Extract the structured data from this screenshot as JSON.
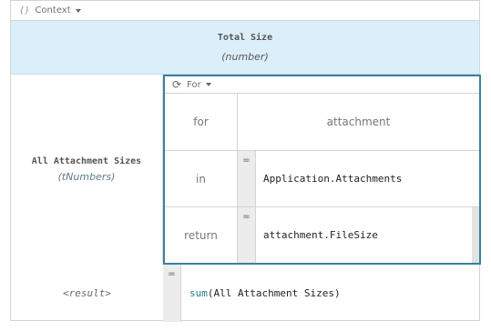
{
  "context_bar": {
    "icon": "{}",
    "label": "Context"
  },
  "header": {
    "title": "Total Size",
    "type": "(number)"
  },
  "entry": {
    "name": "All Attachment Sizes",
    "type": "(tNumbers)"
  },
  "for_bar": {
    "label": "For"
  },
  "rows": [
    {
      "label": "for",
      "value": "attachment"
    },
    {
      "label": "in",
      "eq": "=",
      "value": "Application.Attachments"
    },
    {
      "label": "return",
      "eq": "=",
      "value": "attachment.FileSize"
    }
  ],
  "result": {
    "label": "<result>",
    "eq": "=",
    "func": "sum",
    "args": "(All Attachment Sizes)"
  },
  "colors": {
    "header_bg": "#dbeffb",
    "for_border": "#3a7fa0",
    "function_color": "#2b7a8c"
  }
}
